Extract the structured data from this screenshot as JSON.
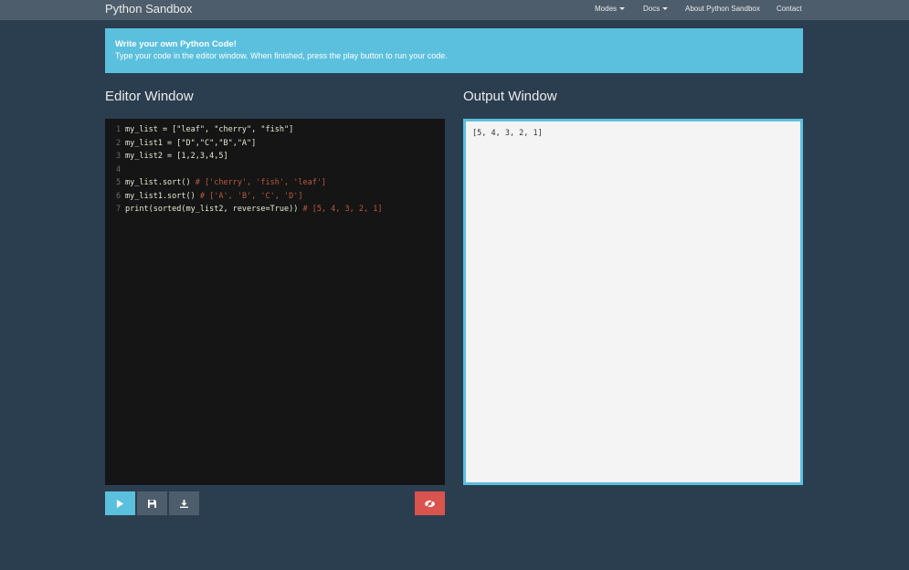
{
  "navbar": {
    "brand": "Python Sandbox",
    "items": [
      {
        "label": "Modes",
        "dropdown": true
      },
      {
        "label": "Docs",
        "dropdown": true
      },
      {
        "label": "About Python Sandbox",
        "dropdown": false
      },
      {
        "label": "Contact",
        "dropdown": false
      }
    ]
  },
  "alert": {
    "title": "Write your own Python Code!",
    "text": "Type your code in the editor window. When finished, press the play button to run your code."
  },
  "editor": {
    "title": "Editor Window",
    "lines": [
      {
        "num": "1",
        "code": "my_list = [\"leaf\", \"cherry\", \"fish\"]",
        "comment": ""
      },
      {
        "num": "2",
        "code": "my_list1 = [\"D\",\"C\",\"B\",\"A\"]",
        "comment": ""
      },
      {
        "num": "3",
        "code": "my_list2 = [1,2,3,4,5]",
        "comment": ""
      },
      {
        "num": "4",
        "code": "",
        "comment": ""
      },
      {
        "num": "5",
        "code": "my_list.sort() ",
        "comment": "# ['cherry', 'fish', 'leaf']"
      },
      {
        "num": "6",
        "code": "my_list1.sort() ",
        "comment": "# ['A', 'B', 'C', 'D']"
      },
      {
        "num": "7",
        "code": "print(sorted(my_list2, reverse=True)) ",
        "comment": "# [5, 4, 3, 2, 1]"
      }
    ]
  },
  "output": {
    "title": "Output Window",
    "text": "[5, 4, 3, 2, 1]"
  },
  "toolbar": {
    "play_icon": "play-icon",
    "save_icon": "save-icon",
    "download_icon": "download-icon",
    "visibility_icon": "eye-slash-icon"
  },
  "colors": {
    "background": "#2b3e50",
    "navbar": "#4e5d6c",
    "info": "#5bc0de",
    "danger": "#d9534f",
    "editor_bg": "#151515"
  }
}
